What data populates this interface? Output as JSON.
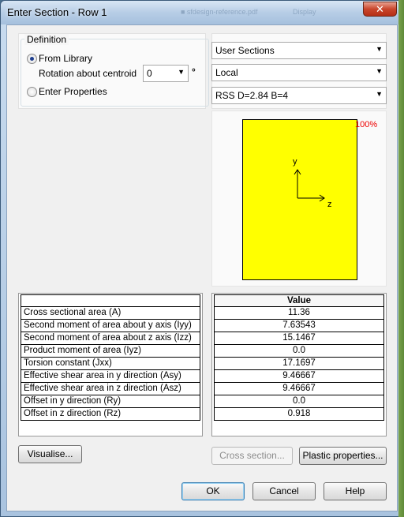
{
  "window": {
    "title": "Enter Section - Row 1",
    "close_label": "✕",
    "background_texts": [
      "■ sfdesign-reference.pdf",
      "Display"
    ]
  },
  "definition": {
    "legend": "Definition",
    "from_library_label": "From Library",
    "rotation_label": "Rotation about centroid",
    "rotation_value": "0",
    "rotation_unit": "°",
    "enter_properties_label": "Enter Properties"
  },
  "dropdowns": {
    "library": "User Sections",
    "axes": "Local",
    "section": "RSS D=2.84 B=4"
  },
  "preview": {
    "scale_label": "100%",
    "axis_y": "y",
    "axis_z": "z",
    "fill_color": "#ffff00"
  },
  "properties": {
    "value_header": "Value",
    "rows": [
      {
        "label": "Cross sectional area (A)",
        "value": "11.36"
      },
      {
        "label": "Second moment of area about y axis (Iyy)",
        "value": "7.63543"
      },
      {
        "label": "Second moment of area about z axis (Izz)",
        "value": "15.1467"
      },
      {
        "label": "Product moment of area (Iyz)",
        "value": "0.0"
      },
      {
        "label": "Torsion constant (Jxx)",
        "value": "17.1697"
      },
      {
        "label": "Effective shear area in y direction (Asy)",
        "value": "9.46667"
      },
      {
        "label": "Effective shear area in z direction (Asz)",
        "value": "9.46667"
      },
      {
        "label": "Offset in y direction (Ry)",
        "value": "0.0"
      },
      {
        "label": "Offset in z direction (Rz)",
        "value": "0.918"
      }
    ]
  },
  "buttons": {
    "visualise": "Visualise...",
    "cross_section": "Cross section...",
    "plastic_properties": "Plastic properties...",
    "ok": "OK",
    "cancel": "Cancel",
    "help": "Help"
  }
}
